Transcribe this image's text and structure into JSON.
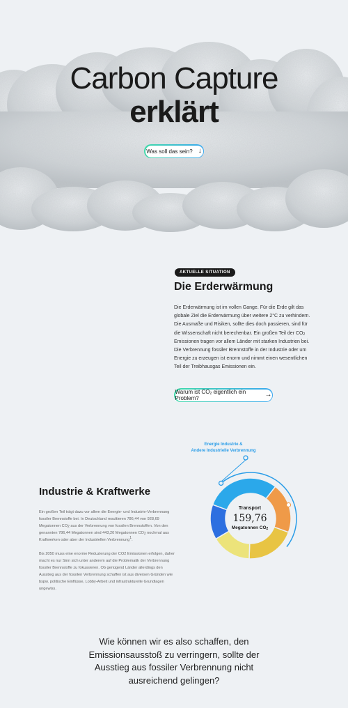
{
  "hero": {
    "title_line1": "Carbon Capture",
    "title_line2": "erklärt",
    "button_label": "Was soll das sein?",
    "button_icon": "arrow-down-icon"
  },
  "situation": {
    "badge": "AKTUELLE SITUATION",
    "title": "Die Erderwärmung",
    "text_parts": [
      "Die Erderwärmung ist im vollen Gange. Für die Erde gilt das globale Ziel die Erderwärmung über weitere 2°C zu verhindern. Die Ausmaße und Risiken, sollte dies doch passieren, sind für die Wissenschaft nicht berechenbar. Ein großen Teil der CO",
      "2",
      " Emissionen tragen vor allem Länder mit starken Industrien bei. Die Verbrennung fossiler Brennstoffe in der Industrie oder um Energie zu erzeugen ist enorm und nimmt einen wesentlichen Teil der Treibhausgas Emissionen ein."
    ],
    "button_parts": [
      "Warum ist CO",
      "2",
      " eigentlich ein Problem?"
    ],
    "button_icon": "arrow-right-icon"
  },
  "industry": {
    "title": "Industrie & Kraftwerke",
    "para1_parts": [
      "Ein großen Teil trägt dazu vor allem die Energie- und Industrie-Verbrennung fossiler Brennstoffe bei. In Deutschland resultieren 786,44 von 928,69 Megatonnen CO",
      "2",
      " aus der Verbrennung von fossilen Brennstoffen. Von den genannten 786,44 Megatonnen sind 443,20 Megatonnen CO",
      "2",
      " nochmal aus Kraftwerken oder aber der Industriellen Verbrennung",
      "1",
      "."
    ],
    "para2": "Bis 2050 muss eine enorme Reduzierung der CO2 Emissionen erfolgen, daher macht es nur Sinn sich unter anderem auf die Problematik der Verbrennung fossiler Brennstoffe zu fokussieren. Ob genügend Länder allerdings den Ausstieg aus der fossilen Verbrennung schaffen ist aus diversen Gründen wie bspw. politische Einflüsse, Lobby-Arbeit und infrastrukturelle Grundlagen ungewiss."
  },
  "chart_data": {
    "type": "pie",
    "callout_line1": "Energie Industrie &",
    "callout_line2": "Andere Industrielle Verbrennung",
    "center_label": "Transport",
    "center_value": "159,76",
    "center_unit_parts": [
      "Megatonnen CO",
      "2"
    ],
    "segments": [
      {
        "color": "#2ba8ea",
        "value": 30
      },
      {
        "color": "#ef9a48",
        "value": 20
      },
      {
        "color": "#e8c443",
        "value": 20
      },
      {
        "color": "#ece37a",
        "value": 16
      },
      {
        "color": "#2d6fe0",
        "value": 14
      }
    ],
    "accent_color": "#2a9de8"
  },
  "closing": {
    "question": "Wie können wir es also schaffen, den Emissionsausstoß zu verringern, sollte der Ausstieg aus fossiler Verbrennung nicht ausreichend gelingen?"
  }
}
